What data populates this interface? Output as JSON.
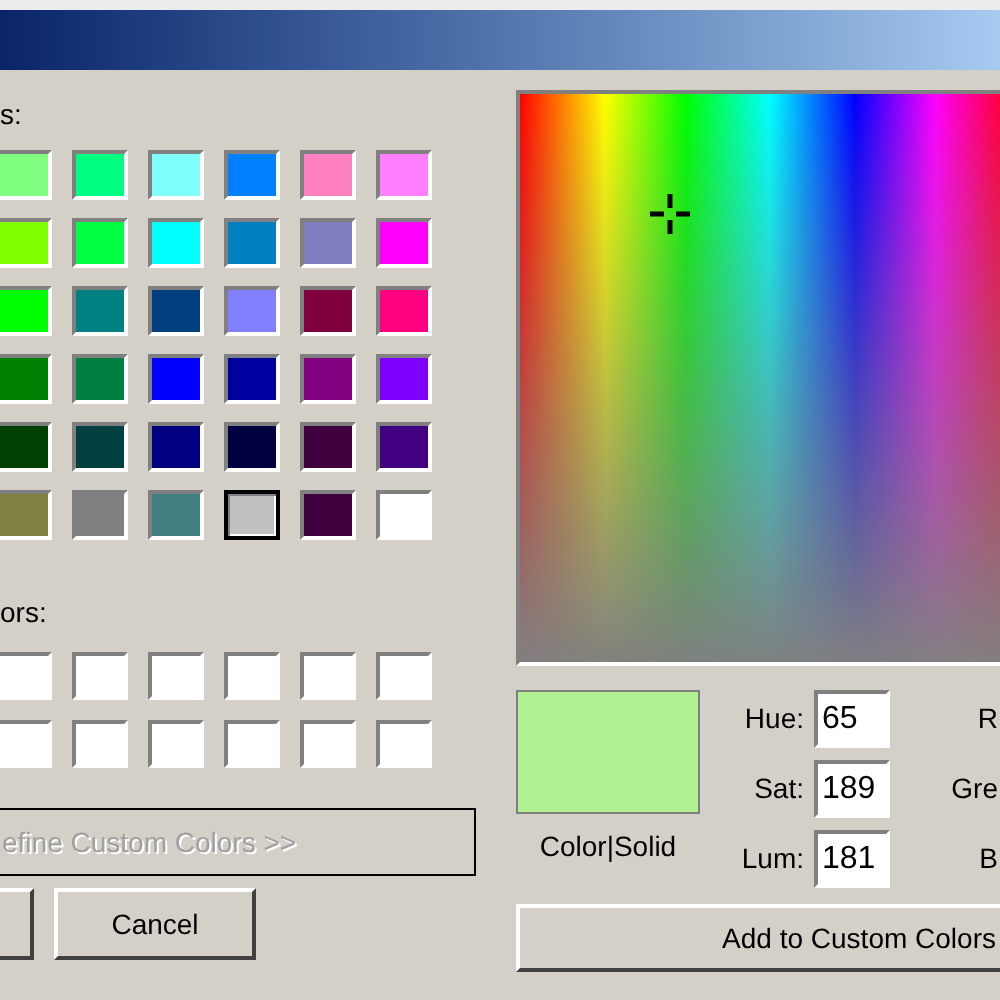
{
  "basic_colors": {
    "label": "s:",
    "swatches": [
      {
        "color": "#80ff80",
        "selected": false
      },
      {
        "color": "#00ff80",
        "selected": false
      },
      {
        "color": "#80ffff",
        "selected": false
      },
      {
        "color": "#0080ff",
        "selected": false
      },
      {
        "color": "#ff80c0",
        "selected": false
      },
      {
        "color": "#ff80ff",
        "selected": false
      },
      {
        "color": "#80ff00",
        "selected": false
      },
      {
        "color": "#00ff40",
        "selected": false
      },
      {
        "color": "#00ffff",
        "selected": false
      },
      {
        "color": "#0080c0",
        "selected": false
      },
      {
        "color": "#8080c0",
        "selected": false
      },
      {
        "color": "#ff00ff",
        "selected": false
      },
      {
        "color": "#00ff00",
        "selected": false
      },
      {
        "color": "#008080",
        "selected": false
      },
      {
        "color": "#004080",
        "selected": false
      },
      {
        "color": "#8080ff",
        "selected": false
      },
      {
        "color": "#800040",
        "selected": false
      },
      {
        "color": "#ff0080",
        "selected": false
      },
      {
        "color": "#008000",
        "selected": false
      },
      {
        "color": "#008040",
        "selected": false
      },
      {
        "color": "#0000ff",
        "selected": false
      },
      {
        "color": "#0000a0",
        "selected": false
      },
      {
        "color": "#800080",
        "selected": false
      },
      {
        "color": "#8000ff",
        "selected": false
      },
      {
        "color": "#004000",
        "selected": false
      },
      {
        "color": "#004040",
        "selected": false
      },
      {
        "color": "#000080",
        "selected": false
      },
      {
        "color": "#000040",
        "selected": false
      },
      {
        "color": "#400040",
        "selected": false
      },
      {
        "color": "#400080",
        "selected": false
      },
      {
        "color": "#808040",
        "selected": false
      },
      {
        "color": "#808080",
        "selected": false
      },
      {
        "color": "#408080",
        "selected": false
      },
      {
        "color": "#c0c0c0",
        "selected": true
      },
      {
        "color": "#400040",
        "selected": false
      },
      {
        "color": "#ffffff",
        "selected": false
      }
    ]
  },
  "custom_colors": {
    "label": "ors:",
    "swatches": [
      {
        "color": "#ffffff"
      },
      {
        "color": "#ffffff"
      },
      {
        "color": "#ffffff"
      },
      {
        "color": "#ffffff"
      },
      {
        "color": "#ffffff"
      },
      {
        "color": "#ffffff"
      },
      {
        "color": "#ffffff"
      },
      {
        "color": "#ffffff"
      },
      {
        "color": "#ffffff"
      },
      {
        "color": "#ffffff"
      },
      {
        "color": "#ffffff"
      },
      {
        "color": "#ffffff"
      }
    ]
  },
  "define_button": {
    "label": "efine Custom Colors >>",
    "disabled": true
  },
  "buttons": [
    {
      "kind": "cut"
    },
    {
      "kind": "labelled",
      "label": "Cancel"
    }
  ],
  "preview": {
    "color": "#b0f090",
    "label": "Color|Solid"
  },
  "fields": [
    {
      "label": "Hue:",
      "value": "65"
    },
    {
      "label": "Sat:",
      "value": "189"
    },
    {
      "label": "Lum:",
      "value": "181"
    }
  ],
  "right_labels": [
    "R",
    "Gre",
    "B"
  ],
  "add_button": {
    "label": "Add to Custom Colors"
  }
}
